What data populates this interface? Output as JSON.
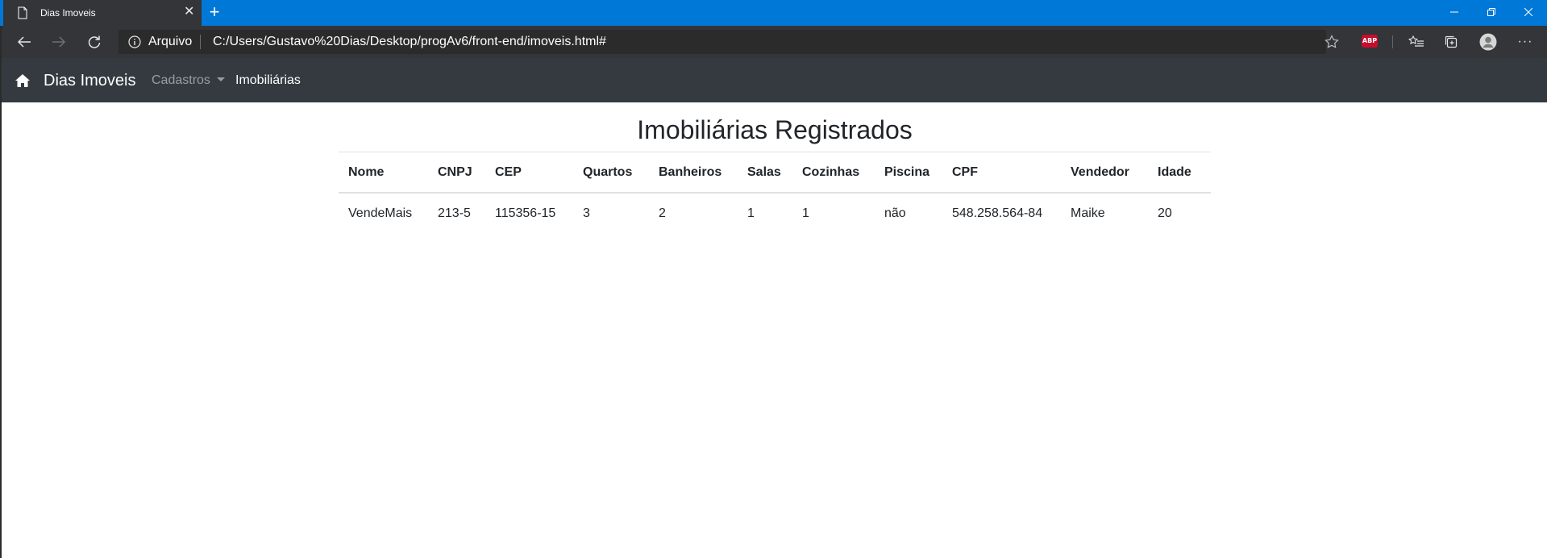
{
  "browser": {
    "tab_title": "Dias Imoveis",
    "tab_close": "✕",
    "new_tab": "+",
    "protocol_label": "Arquivo",
    "url": "C:/Users/Gustavo%20Dias/Desktop/progAv6/front-end/imoveis.html#",
    "abp_label": "ABP",
    "more_label": "···"
  },
  "navbar": {
    "brand": "Dias Imoveis",
    "dropdown_label": "Cadastros",
    "link_label": "Imobiliárias"
  },
  "main": {
    "title": "Imobiliárias Registrados",
    "table": {
      "headers": [
        "Nome",
        "CNPJ",
        "CEP",
        "Quartos",
        "Banheiros",
        "Salas",
        "Cozinhas",
        "Piscina",
        "CPF",
        "Vendedor",
        "Idade"
      ],
      "rows": [
        [
          "VendeMais",
          "213-5",
          "115356-15",
          "3",
          "2",
          "1",
          "1",
          "não",
          "548.258.564-84",
          "Maike",
          "20"
        ]
      ]
    }
  },
  "colors": {
    "titlebar": "#0078d7",
    "toolbar": "#333538",
    "navbar": "#343a40",
    "abp": "#c70d2c"
  }
}
